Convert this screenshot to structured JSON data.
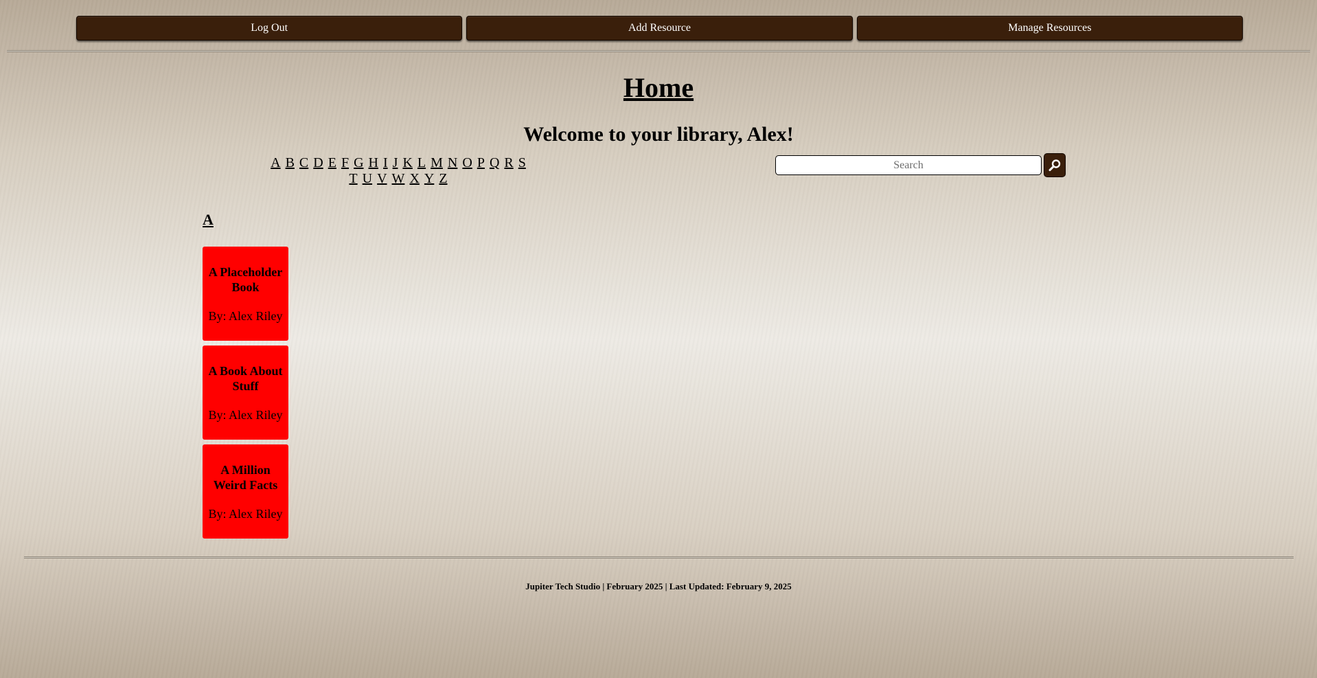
{
  "nav": {
    "logout_label": "Log Out",
    "add_resource_label": "Add Resource",
    "manage_resources_label": "Manage Resources"
  },
  "page": {
    "title": "Home",
    "welcome": "Welcome to your library, Alex!"
  },
  "alphabet": [
    "A",
    "B",
    "C",
    "D",
    "E",
    "F",
    "G",
    "H",
    "I",
    "J",
    "K",
    "L",
    "M",
    "N",
    "O",
    "P",
    "Q",
    "R",
    "S",
    "T",
    "U",
    "V",
    "W",
    "X",
    "Y",
    "Z"
  ],
  "search": {
    "placeholder": "Search",
    "value": "",
    "icon": "magnifier-icon"
  },
  "section": {
    "letter": "A",
    "books": [
      {
        "title": "A Placeholder Book",
        "author": "By: Alex Riley"
      },
      {
        "title": "A Book About Stuff",
        "author": "By: Alex Riley"
      },
      {
        "title": "A Million Weird Facts",
        "author": "By: Alex Riley"
      }
    ]
  },
  "footer": {
    "text": "Jupiter Tech Studio | February 2025 | Last Updated: February 9, 2025"
  },
  "colors": {
    "nav_button": "#3a1f0b",
    "book_card": "#ff0000",
    "text": "#000000"
  }
}
